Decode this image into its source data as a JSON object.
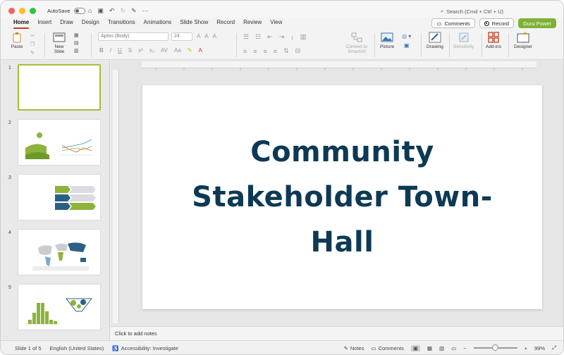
{
  "titlebar": {
    "autosave_label": "AutoSave",
    "search_placeholder": "Search (Cmd + Ctrl + U)"
  },
  "tabs": [
    "Home",
    "Insert",
    "Draw",
    "Design",
    "Transitions",
    "Animations",
    "Slide Show",
    "Record",
    "Review",
    "View"
  ],
  "active_tab": "Home",
  "top_buttons": {
    "comments": "Comments",
    "record": "Record",
    "guru": "Guru Power"
  },
  "ribbon": {
    "paste": "Paste",
    "new_slide_line1": "New",
    "new_slide_line2": "Slide",
    "font_name": "Aptos (Body)",
    "font_size": "24",
    "convert_line1": "Convert to",
    "convert_line2": "SmartArt",
    "picture": "Picture",
    "drawing": "Drawing",
    "sensitivity": "Sensitivity",
    "addins": "Add-ins",
    "designer": "Designer"
  },
  "thumbnails": [
    "1",
    "2",
    "3",
    "4",
    "5"
  ],
  "slide": {
    "title_line1": "Community",
    "title_line2": "Stakeholder Town-",
    "title_line3": "Hall"
  },
  "notes_placeholder": "Click to add notes",
  "status": {
    "slide_counter": "Slide 1 of 5",
    "language": "English (United States)",
    "accessibility": "Accessibility: Investigate",
    "notes": "Notes",
    "comments": "Comments",
    "zoom": "99%",
    "zoom_fraction": 0.5
  },
  "colors": {
    "title": "#0d3954",
    "accent_green": "#7fb234",
    "tab_underline": "#c43e1c",
    "thumb_selected": "#a6bd3a"
  }
}
